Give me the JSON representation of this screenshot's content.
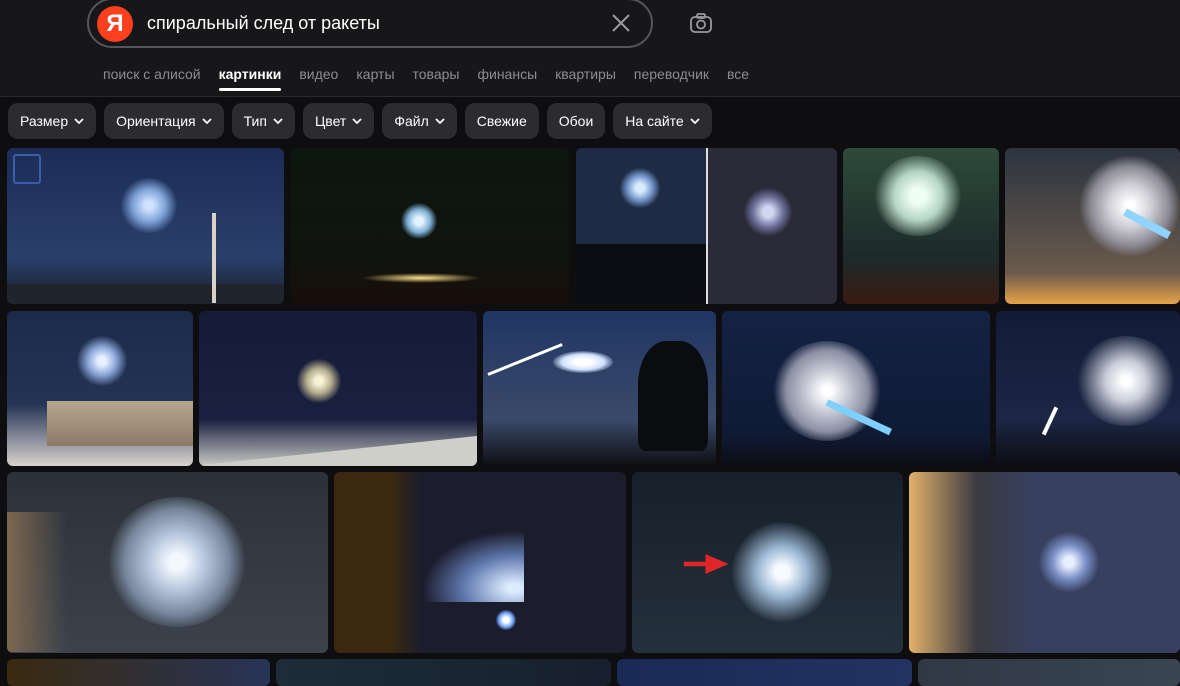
{
  "search": {
    "logo_letter": "Я",
    "query": "спиральный след от ракеты"
  },
  "tabs": [
    {
      "label": "поиск с алисой"
    },
    {
      "label": "картинки",
      "active": true
    },
    {
      "label": "видео"
    },
    {
      "label": "карты"
    },
    {
      "label": "товары"
    },
    {
      "label": "финансы"
    },
    {
      "label": "квартиры"
    },
    {
      "label": "переводчик"
    },
    {
      "label": "все"
    }
  ],
  "filters": [
    {
      "label": "Размер",
      "dropdown": true
    },
    {
      "label": "Ориентация",
      "dropdown": true
    },
    {
      "label": "Тип",
      "dropdown": true
    },
    {
      "label": "Цвет",
      "dropdown": true
    },
    {
      "label": "Файл",
      "dropdown": true
    },
    {
      "label": "Свежие",
      "dropdown": false
    },
    {
      "label": "Обои",
      "dropdown": false
    },
    {
      "label": "На сайте",
      "dropdown": true
    }
  ],
  "colors": {
    "accent": "#fc3f1d",
    "background": "#0e0e10",
    "header": "#17171a",
    "chip": "#2c2c30"
  },
  "icons": {
    "camera": "camera-search-icon",
    "clear": "close-icon",
    "chevron": "chevron-down-icon"
  }
}
